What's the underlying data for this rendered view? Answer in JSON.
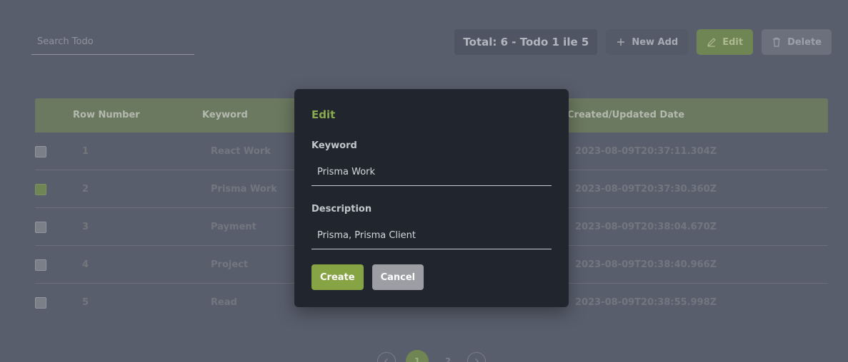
{
  "search": {
    "placeholder": "Search Todo",
    "value": ""
  },
  "toolbar": {
    "total_label": "Total: 6 - Todo 1 ile 5",
    "new_label": "New Add",
    "edit_label": "Edit",
    "delete_label": "Delete"
  },
  "table": {
    "headers": {
      "row_number": "Row Number",
      "keyword": "Keyword",
      "date": "Created/Updated Date"
    },
    "rows": [
      {
        "num": "1",
        "keyword": "React Work",
        "date": "2023-08-09T20:37:11.304Z",
        "selected": false
      },
      {
        "num": "2",
        "keyword": "Prisma Work",
        "date": "2023-08-09T20:37:30.360Z",
        "selected": true
      },
      {
        "num": "3",
        "keyword": "Payment",
        "date": "2023-08-09T20:38:04.670Z",
        "selected": false
      },
      {
        "num": "4",
        "keyword": "Project",
        "date": "2023-08-09T20:38:40.966Z",
        "selected": false
      },
      {
        "num": "5",
        "keyword": "Read",
        "date": "2023-08-09T20:38:55.998Z",
        "selected": false
      }
    ]
  },
  "pagination": {
    "pages": [
      "1",
      "2"
    ],
    "current": "1"
  },
  "modal": {
    "title": "Edit",
    "keyword_label": "Keyword",
    "keyword_value": "Prisma Work",
    "description_label": "Description",
    "description_value": "Prisma, Prisma Client",
    "create_label": "Create",
    "cancel_label": "Cancel"
  },
  "colors": {
    "accent": "#86a444",
    "modal_bg": "#21252d",
    "overlay_bg": "#585e6c"
  }
}
